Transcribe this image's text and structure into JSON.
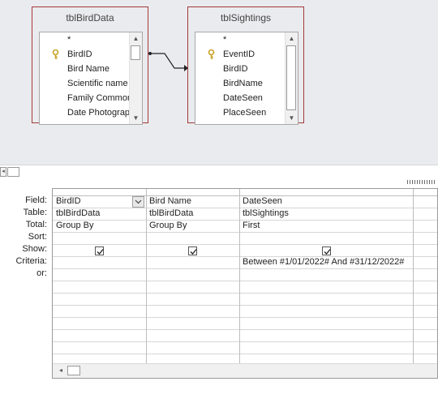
{
  "tables": [
    {
      "title": "tblBirdData",
      "fields": [
        "*",
        "BirdID",
        "Bird Name",
        "Scientific name",
        "Family Common",
        "Date Photograph"
      ],
      "key_field_index": 1
    },
    {
      "title": "tblSightings",
      "fields": [
        "*",
        "EventID",
        "BirdID",
        "BirdName",
        "DateSeen",
        "PlaceSeen"
      ],
      "key_field_index": 1
    }
  ],
  "grid": {
    "row_labels": [
      "Field:",
      "Table:",
      "Total:",
      "Sort:",
      "Show:",
      "Criteria:",
      "or:"
    ],
    "columns": [
      {
        "field": "BirdID",
        "table": "tblBirdData",
        "total": "Group By",
        "sort": "",
        "show": true,
        "criteria": "",
        "or": ""
      },
      {
        "field": "Bird Name",
        "table": "tblBirdData",
        "total": "Group By",
        "sort": "",
        "show": true,
        "criteria": "",
        "or": ""
      },
      {
        "field": "DateSeen",
        "table": "tblSightings",
        "total": "First",
        "sort": "",
        "show": true,
        "criteria": "Between #1/01/2022# And #31/12/2022#",
        "or": ""
      }
    ]
  },
  "icons": {
    "key": "primary-key-icon",
    "scroll_up": "scroll-up-arrow-icon",
    "scroll_down": "scroll-down-arrow-icon",
    "scroll_left": "scroll-left-arrow-icon",
    "dropdown": "chevron-down-icon"
  },
  "colors": {
    "table_border": "#a33a3a",
    "design_pane_bg": "#eaebee",
    "key_gold": "#c9a227"
  }
}
